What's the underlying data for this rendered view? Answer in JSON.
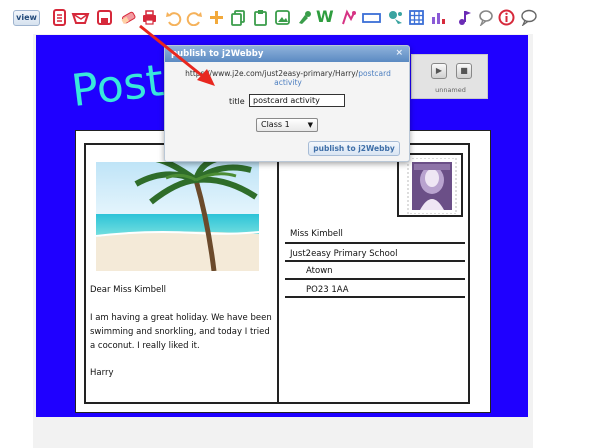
{
  "toolbar": {
    "view_label": "view",
    "icons": [
      "note-icon",
      "envelope-icon",
      "save-icon",
      "eraser-icon",
      "print-icon",
      "undo-icon",
      "redo-icon",
      "add-icon",
      "copy-icon",
      "paste-icon",
      "image-icon",
      "paint-icon",
      "word-icon",
      "draw-icon",
      "textbox-icon",
      "animate-icon",
      "table-icon",
      "chart-icon",
      "music-icon",
      "speech-bubble-icon",
      "info-icon",
      "comment-icon"
    ],
    "word_label": "W"
  },
  "canvas": {
    "title_text": "Postc",
    "background_color": "#1f00ff",
    "title_color": "#39e6dc"
  },
  "media_panel": {
    "label": "unnamed"
  },
  "dialog": {
    "title": "publish to j2Webby",
    "close": "×",
    "url_prefix": "https://www.j2e.com/just2easy-primary/Harry/",
    "url_link": "postcard activity",
    "title_label": "title",
    "title_value": "postcard activity",
    "class_value": "Class 1",
    "publish_button": "publish to j2Webby"
  },
  "postcard": {
    "address": [
      "Miss Kimbell",
      "Just2easy Primary School",
      "Atown",
      "PO23 1AA"
    ],
    "greeting": "Dear Miss Kimbell",
    "body": [
      "I am having a great holiday. We have been",
      "swimming and snorkling, and today I tried",
      "a coconut. I really liked it."
    ],
    "signature": "Harry"
  }
}
